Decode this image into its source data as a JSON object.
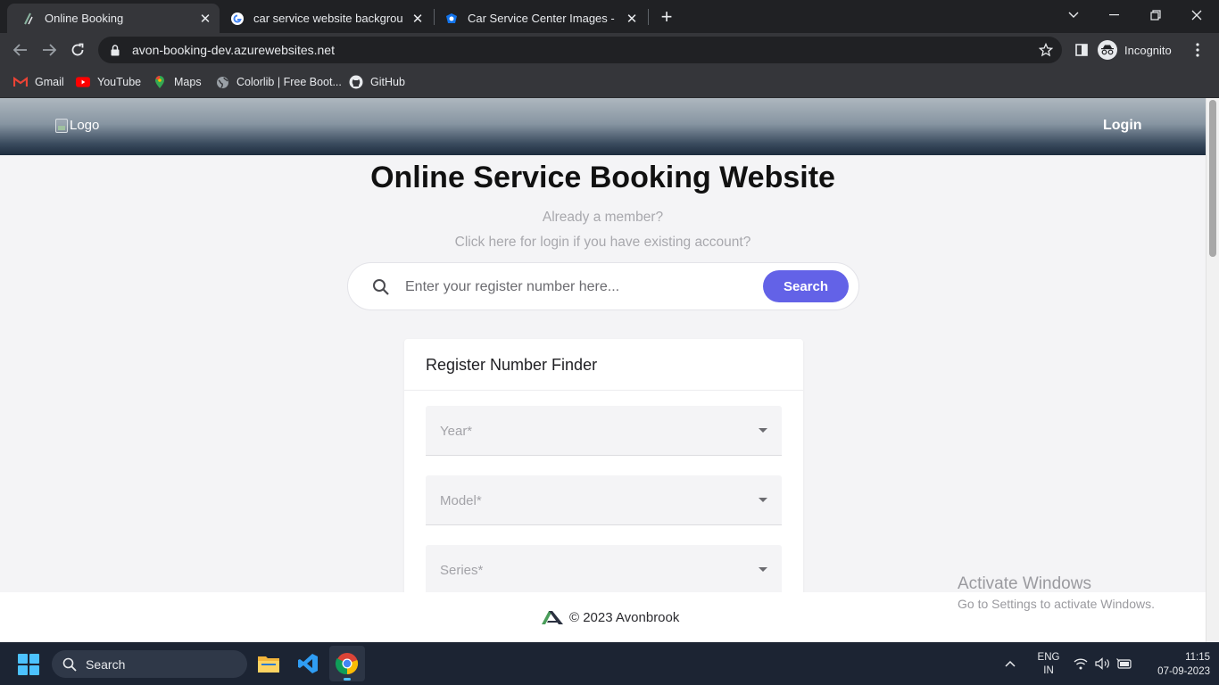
{
  "browser": {
    "tabs": [
      {
        "title": "Online Booking",
        "favicon": "site-favicon",
        "active": true
      },
      {
        "title": "car service website background i",
        "favicon": "google-icon",
        "active": false
      },
      {
        "title": "Car Service Center Images - Free",
        "favicon": "freepik-icon",
        "active": false
      }
    ],
    "new_tab_label": "+",
    "url": "avon-booking-dev.azurewebsites.net",
    "profile_label": "Incognito",
    "bookmarks": [
      {
        "label": "Gmail",
        "icon": "gmail-icon"
      },
      {
        "label": "YouTube",
        "icon": "youtube-icon"
      },
      {
        "label": "Maps",
        "icon": "maps-icon"
      },
      {
        "label": "Colorlib | Free Boot...",
        "icon": "globe-icon"
      },
      {
        "label": "GitHub",
        "icon": "github-icon"
      }
    ]
  },
  "site": {
    "header": {
      "logo_alt": "Logo",
      "login_label": "Login"
    },
    "hero": {
      "title": "Online Service Booking Website",
      "subtitle_1": "Already a member?",
      "subtitle_2": "Click here for login if you have existing account?"
    },
    "search": {
      "placeholder": "Enter your register number here...",
      "button_label": "Search"
    },
    "finder": {
      "title": "Register Number Finder",
      "fields": [
        {
          "label": "Year*"
        },
        {
          "label": "Model*"
        },
        {
          "label": "Series*"
        }
      ]
    },
    "footer": {
      "text": "© 2023 Avonbrook"
    }
  },
  "watermark": {
    "line1": "Activate Windows",
    "line2": "Go to Settings to activate Windows."
  },
  "taskbar": {
    "search_label": "Search",
    "apps": [
      "file-explorer-icon",
      "vscode-icon",
      "chrome-icon"
    ],
    "lang_line1": "ENG",
    "lang_line2": "IN",
    "time": "11:15",
    "date": "07-09-2023"
  },
  "colors": {
    "accent": "#6362e7",
    "page_bg": "#f4f4f6",
    "chrome_dark": "#202124",
    "chrome_toolbar": "#35363a",
    "taskbar": "#1c2433"
  }
}
